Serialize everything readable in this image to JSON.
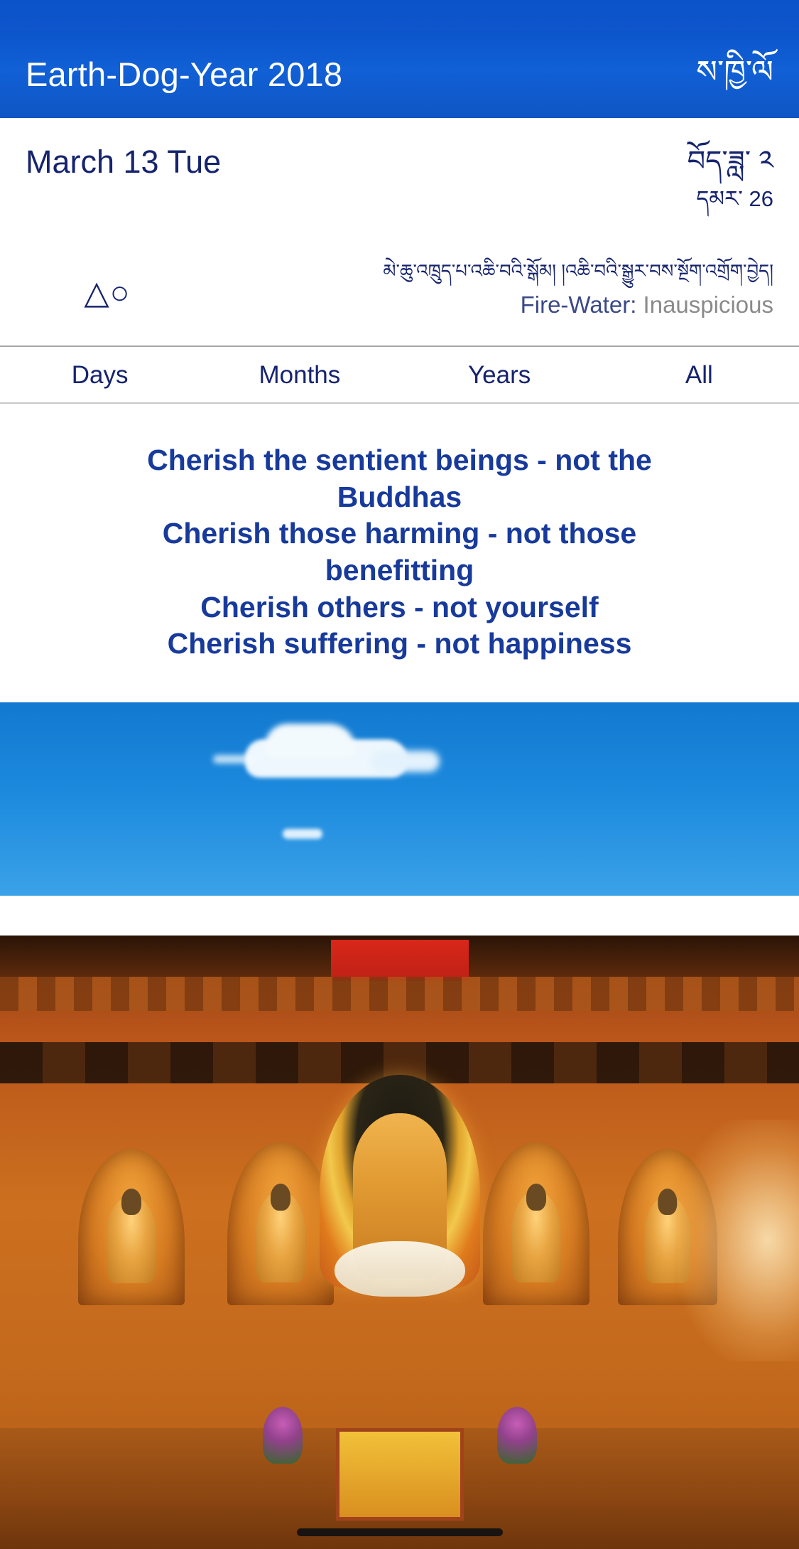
{
  "statusbar": {
    "present": true
  },
  "header": {
    "title": "Earth-Dog-Year 2018",
    "tibetan_title": "ས་ཁྱི་ལོ",
    "background_color": "#1160d6",
    "text_color": "#ffffff"
  },
  "date": {
    "gregorian": "March 13 Tue",
    "tibetan_month": "བོད་ཟླ་ ༢",
    "tibetan_day": "དམར་ 26",
    "text_color": "#16246e"
  },
  "omen": {
    "symbol": "△○",
    "tibetan_line": "མེ་ཆུ་འཁྲུད་པ་འཆི་བའི་སྒོམ།  །འཆི་བའི་སྒྱུར་བས་སྔོག་འགྲོག་བྱེད།",
    "element_label": "Fire-Water:",
    "element_value": "Inauspicious",
    "label_color": "#3b4a86",
    "value_color": "#8a8a8a"
  },
  "tabs": [
    {
      "label": "Days",
      "selected": false
    },
    {
      "label": "Months",
      "selected": false
    },
    {
      "label": "Years",
      "selected": false
    },
    {
      "label": "All",
      "selected": false
    }
  ],
  "quote": {
    "color": "#173a9b",
    "lines": [
      "Cherish the sentient beings - not the",
      "Buddhas",
      "Cherish those harming - not those",
      "benefitting",
      "Cherish others - not yourself",
      "Cherish suffering - not happiness"
    ]
  },
  "photos": [
    {
      "name": "sky-with-cloud",
      "description": "Blue sky with a single white cloud"
    },
    {
      "name": "temple-shrine",
      "description": "Tibetan Buddhist shrine with golden Buddha statues in wooden alcoves"
    }
  ]
}
